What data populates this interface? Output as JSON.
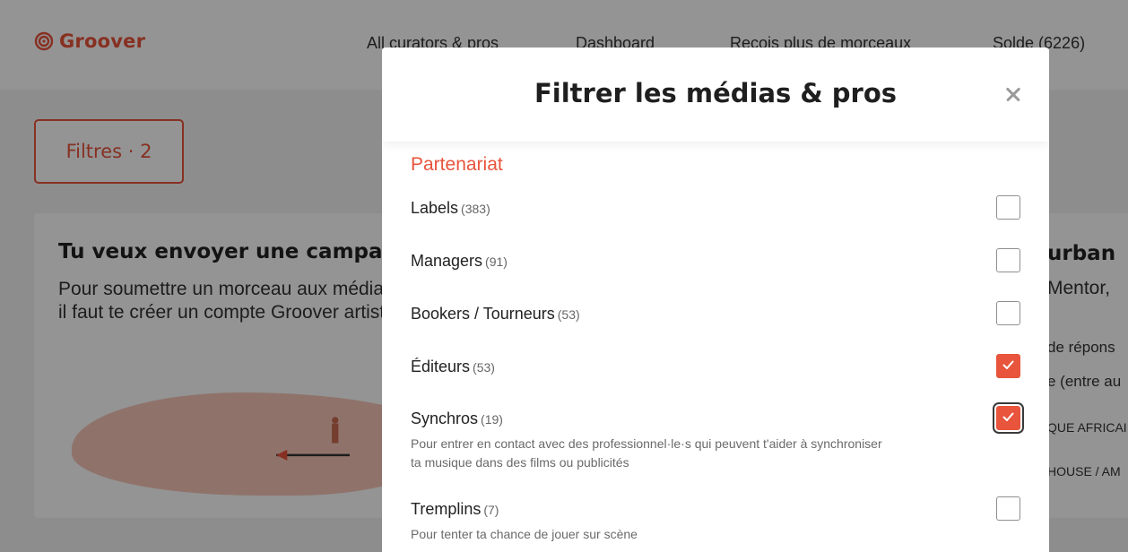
{
  "header": {
    "logo_text": "Groover",
    "nav": [
      "All curators & pros",
      "Dashboard",
      "Reçois plus de morceaux",
      "Solde (6226)"
    ]
  },
  "filters_button": "Filtres · 2",
  "left_card": {
    "title": "Tu veux envoyer une campagne",
    "body": "Pour soumettre un morceau aux médias/pros, il faut te créer un compte Groover artiste !"
  },
  "right_card": {
    "title": "urban",
    "line1": "Mentor,",
    "line2": "de répons",
    "line3": "e (entre au",
    "tag1": "QUE AFRICAI",
    "tag2": "HOUSE / AM"
  },
  "modal": {
    "title": "Filtrer les médias & pros",
    "section": "Partenariat",
    "options": [
      {
        "label": "Labels",
        "count": "(383)",
        "desc": "",
        "checked": false
      },
      {
        "label": "Managers",
        "count": "(91)",
        "desc": "",
        "checked": false
      },
      {
        "label": "Bookers / Tourneurs",
        "count": "(53)",
        "desc": "",
        "checked": false
      },
      {
        "label": "Éditeurs",
        "count": "(53)",
        "desc": "",
        "checked": true
      },
      {
        "label": "Synchros",
        "count": "(19)",
        "desc": "Pour entrer en contact avec des professionnel·le·s qui peuvent t'aider à synchroniser ta musique dans des films ou publicités",
        "checked": true
      },
      {
        "label": "Tremplins",
        "count": "(7)",
        "desc": "Pour tenter ta chance de jouer sur scène",
        "checked": false
      }
    ]
  },
  "colors": {
    "accent": "#e8543c",
    "overlay": "rgba(0,0,0,0.42)"
  }
}
